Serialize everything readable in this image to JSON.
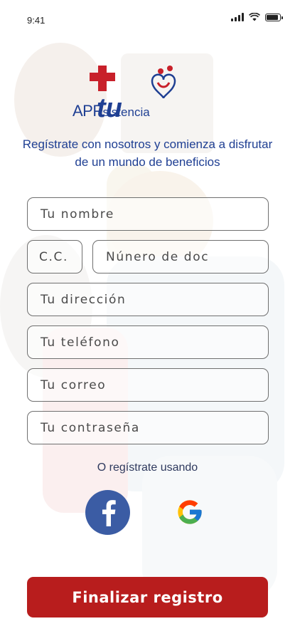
{
  "status_bar": {
    "time": "9:41"
  },
  "logo": {
    "app": "APP",
    "suffix": "sistencia"
  },
  "tagline": "Regístrate con nosotros y comienza a disfrutar de un mundo de beneficios",
  "form": {
    "name_placeholder": "Tu nombre",
    "doc_type_placeholder": "C.C.",
    "doc_number_placeholder": "Núnero de doc",
    "address_placeholder": "Tu dirección",
    "phone_placeholder": "Tu teléfono",
    "email_placeholder": "Tu correo",
    "password_placeholder": "Tu contraseña"
  },
  "alt_signup_label": "O regístrate usando",
  "social": {
    "facebook_icon": "facebook-icon",
    "google_icon": "google-icon"
  },
  "submit_label": "Finalizar registro",
  "colors": {
    "brand_blue": "#1f3f93",
    "brand_red": "#b81d1d",
    "facebook_blue": "#3b5ca4"
  }
}
